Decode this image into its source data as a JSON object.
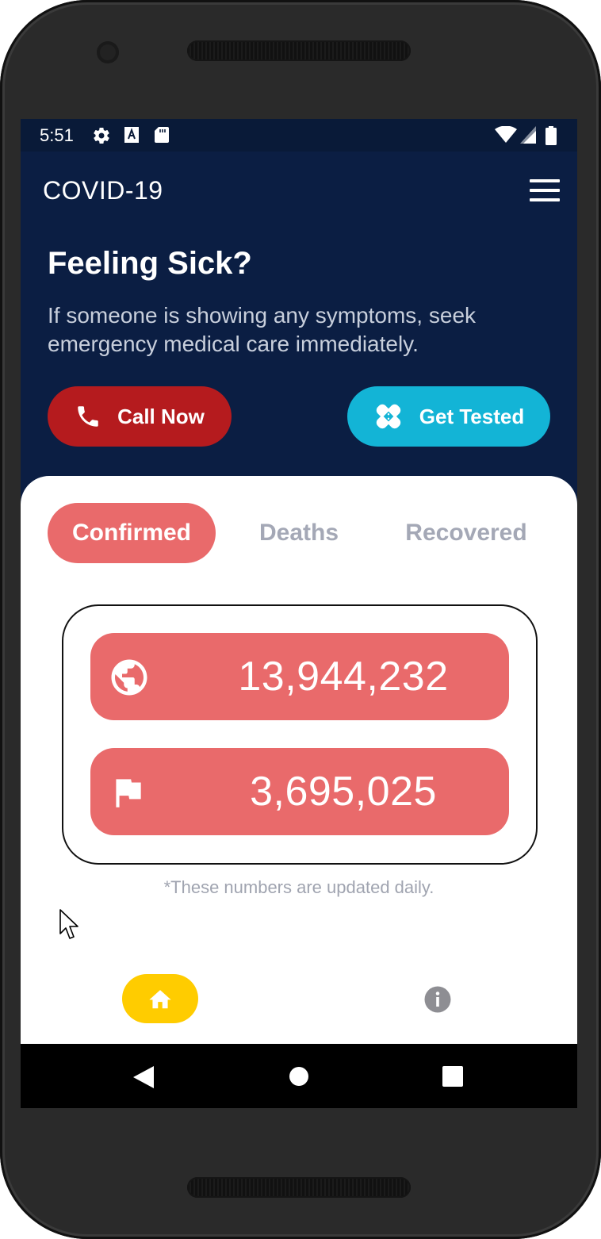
{
  "status_bar": {
    "time": "5:51",
    "icons": [
      "gear-icon",
      "text-a-icon",
      "sd-card-icon",
      "wifi-icon",
      "signal-icon",
      "battery-icon"
    ]
  },
  "app_bar": {
    "title": "COVID-19",
    "menu_icon": "menu-icon"
  },
  "hero": {
    "title": "Feeling Sick?",
    "text": "If someone is showing any symptoms, seek emergency medical care immediately.",
    "buttons": {
      "call_label": "Call Now",
      "call_icon": "phone-icon",
      "test_label": "Get Tested",
      "test_icon": "bandage-icon"
    }
  },
  "tabs": [
    {
      "label": "Confirmed",
      "active": true
    },
    {
      "label": "Deaths",
      "active": false
    },
    {
      "label": "Recovered",
      "active": false
    }
  ],
  "stats": {
    "global": {
      "icon": "globe-icon",
      "value": "13,944,232"
    },
    "country": {
      "icon": "flag-icon",
      "value": "3,695,025"
    }
  },
  "note": "*These numbers are updated daily.",
  "bottom_nav": {
    "items": [
      "home-icon",
      "info-icon"
    ],
    "active": "home-icon"
  },
  "system_nav": [
    "back-icon",
    "home-circle-icon",
    "recents-icon"
  ],
  "colors": {
    "header_bg": "#0b1e43",
    "call_button": "#b51b1e",
    "test_button": "#13b4d6",
    "accent_red": "#e96a6b",
    "nav_active": "#ffcc00",
    "inactive_tab_text": "#a4a8b6"
  }
}
